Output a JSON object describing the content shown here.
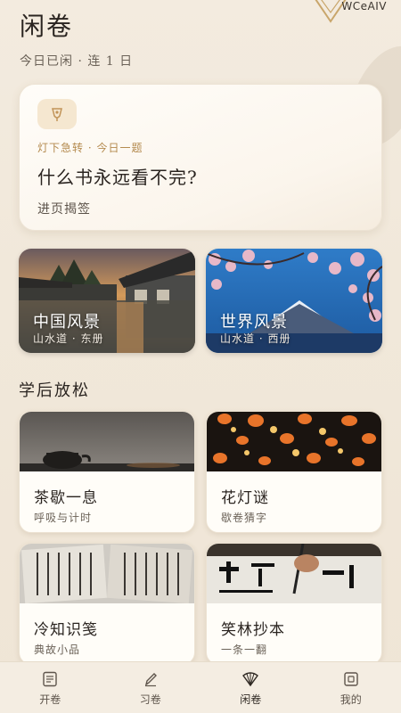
{
  "header": {
    "app_title": "闲卷",
    "streak": "今日已闲 · 连 1 日"
  },
  "logo": {
    "text": "WCeAIV"
  },
  "hero": {
    "kicker": "灯下急转 · 今日一题",
    "question": "什么书永远看不完?",
    "link": "进页揭签",
    "icon": "lamp-icon"
  },
  "scenes": [
    {
      "title": "中国风景",
      "subtitle": "山水道 · 东册"
    },
    {
      "title": "世界风景",
      "subtitle": "山水道 · 西册"
    }
  ],
  "section": {
    "title": "学后放松"
  },
  "tiles": [
    {
      "title": "茶歇一息",
      "subtitle": "呼吸与计时"
    },
    {
      "title": "花灯谜",
      "subtitle": "歇卷猜字"
    },
    {
      "title": "冷知识笺",
      "subtitle": "典故小品"
    },
    {
      "title": "笑林抄本",
      "subtitle": "一条一翻"
    }
  ],
  "tabs": [
    {
      "label": "开卷",
      "icon": "book-icon"
    },
    {
      "label": "习卷",
      "icon": "pen-icon"
    },
    {
      "label": "闲卷",
      "icon": "fan-icon",
      "active": true
    },
    {
      "label": "我的",
      "icon": "profile-icon"
    }
  ],
  "colors": {
    "accent": "#b48a4e",
    "background": "#f1e8da"
  }
}
